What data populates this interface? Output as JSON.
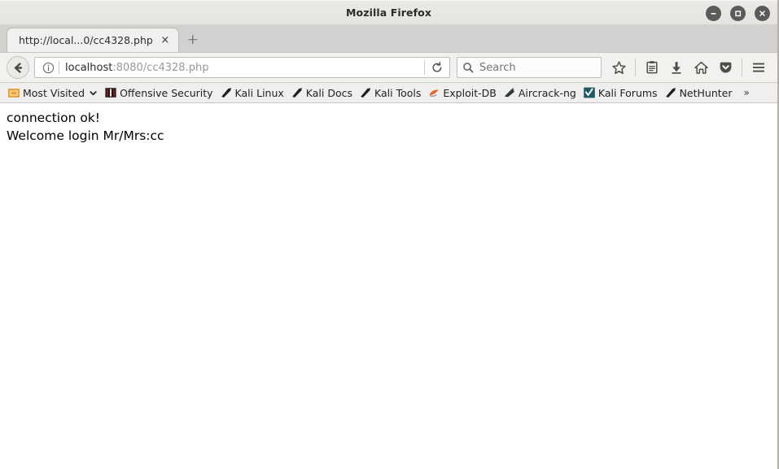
{
  "window": {
    "title": "Mozilla Firefox",
    "controls": [
      {
        "name": "minimize",
        "glyph": "minus"
      },
      {
        "name": "maximize",
        "glyph": "square"
      },
      {
        "name": "close",
        "glyph": "cross"
      }
    ],
    "control_bg": "#5b5b5b"
  },
  "tabs": {
    "active": {
      "label": "http://local...0/cc4328.php",
      "close_label": "×"
    },
    "new_tab_label": "+"
  },
  "toolbar": {
    "back_icon": "back-arrow-icon",
    "identity_icon": "info-circle-icon",
    "url_host": "localhost",
    "url_rest": ":8080/cc4328.php",
    "reload_icon": "reload-icon",
    "search_placeholder": "Search",
    "search_icon": "magnifier-icon",
    "bookmark_icon": "star-icon",
    "library_icon": "library-icon",
    "downloads_icon": "download-arrow-icon",
    "home_icon": "home-icon",
    "pocket_icon": "pocket-icon",
    "menu_icon": "hamburger-menu-icon"
  },
  "bookmarks": {
    "items": [
      {
        "label": "Most Visited",
        "icon": "most-visited-folder-icon",
        "icon_color": "#e8a33d",
        "has_chevron": true
      },
      {
        "label": "Offensive Security",
        "icon": "offensive-security-icon",
        "icon_color": "#8c1b1b",
        "has_chevron": false
      },
      {
        "label": "Kali Linux",
        "icon": "kali-dragon-icon",
        "icon_color": "#1f1f1f",
        "has_chevron": false
      },
      {
        "label": "Kali Docs",
        "icon": "kali-dragon-icon",
        "icon_color": "#1f1f1f",
        "has_chevron": false
      },
      {
        "label": "Kali Tools",
        "icon": "kali-dragon-icon",
        "icon_color": "#1f1f1f",
        "has_chevron": false
      },
      {
        "label": "Exploit-DB",
        "icon": "exploit-db-icon",
        "icon_color": "#e8622a",
        "has_chevron": false
      },
      {
        "label": "Aircrack-ng",
        "icon": "aircrack-ng-icon",
        "icon_color": "#2d3b34",
        "has_chevron": false
      },
      {
        "label": "Kali Forums",
        "icon": "kali-forums-icon",
        "icon_color": "#1c5a66",
        "has_chevron": false
      },
      {
        "label": "NetHunter",
        "icon": "kali-dragon-icon",
        "icon_color": "#1f1f1f",
        "has_chevron": false
      }
    ],
    "overflow_label": "»"
  },
  "page": {
    "lines": [
      "connection ok!",
      "Welcome login Mr/Mrs:cc"
    ]
  }
}
